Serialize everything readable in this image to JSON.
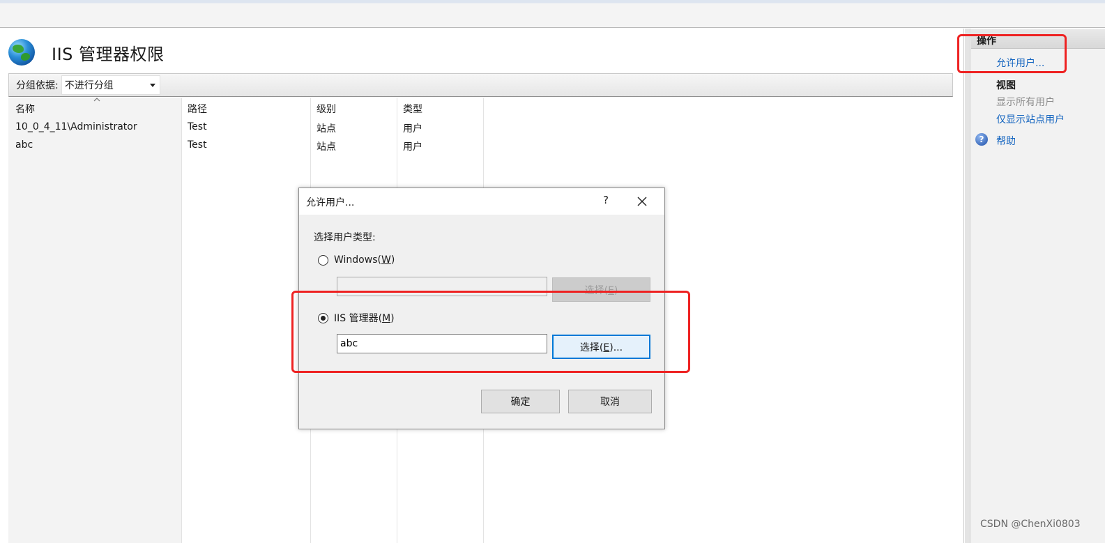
{
  "page": {
    "title": "IIS 管理器权限"
  },
  "group_bar": {
    "label": "分组依据:",
    "selected": "不进行分组"
  },
  "table": {
    "headers": [
      "名称",
      "路径",
      "级别",
      "类型"
    ],
    "rows": [
      [
        "10_0_4_11\\Administrator",
        "Test",
        "站点",
        "用户"
      ],
      [
        "abc",
        "Test",
        "站点",
        "用户"
      ]
    ]
  },
  "actions": {
    "header": "操作",
    "allow_user": "允许用户...",
    "view_heading": "视图",
    "show_all_users": "显示所有用户",
    "show_site_users": "仅显示站点用户",
    "help": "帮助"
  },
  "dialog": {
    "title": "允许用户...",
    "help_glyph": "?",
    "select_type_label": "选择用户类型:",
    "windows_option": "Windows",
    "windows_key": "W",
    "windows_value": "",
    "iis_option": "IIS 管理器",
    "iis_key": "M",
    "iis_value": "abc",
    "select_prefix": "选择(",
    "select_key": "E",
    "select_suffix_disabled": ")",
    "select_suffix": ")...",
    "ok": "确定",
    "cancel": "取消"
  },
  "watermark": "CSDN @ChenXi0803",
  "colors": {
    "link": "#1565c0",
    "highlight_red": "#ee2222",
    "focus_blue": "#0078d7"
  }
}
